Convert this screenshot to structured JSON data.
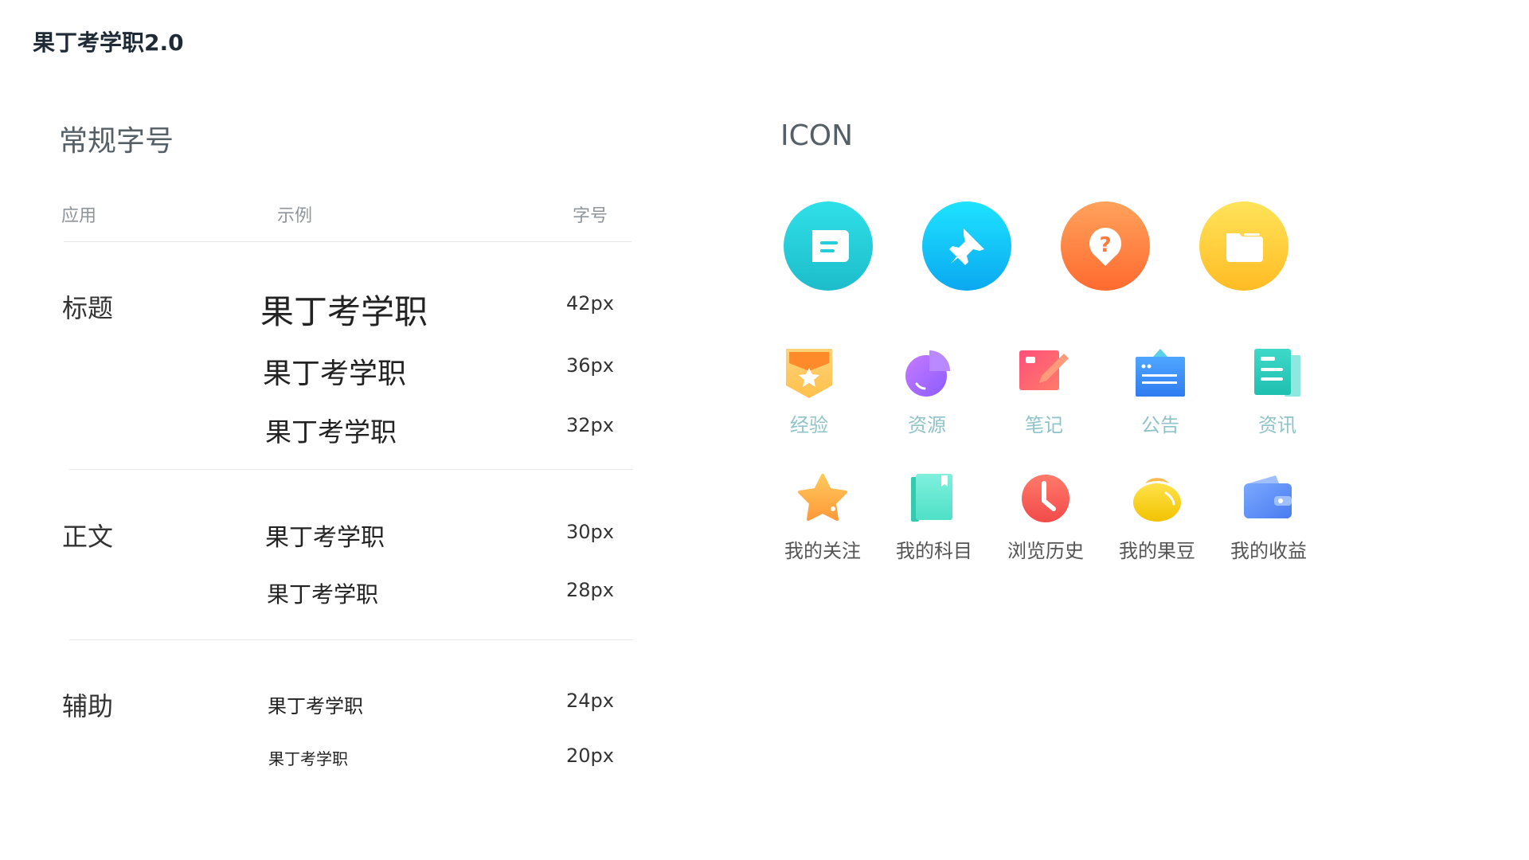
{
  "app": {
    "title": "果丁考学职2.0"
  },
  "typography": {
    "section_title": "常规字号",
    "columns": {
      "usage": "应用",
      "example": "示例",
      "size": "字号"
    },
    "groups": [
      {
        "label": "标题",
        "items": [
          {
            "example": "果丁考学职",
            "size": "42px"
          },
          {
            "example": "果丁考学职",
            "size": "36px"
          },
          {
            "example": "果丁考学职",
            "size": "32px"
          }
        ]
      },
      {
        "label": "正文",
        "items": [
          {
            "example": "果丁考学职",
            "size": "30px"
          },
          {
            "example": "果丁考学职",
            "size": "28px"
          }
        ]
      },
      {
        "label": "辅助",
        "items": [
          {
            "example": "果丁考学职",
            "size": "24px"
          },
          {
            "example": "果丁考学职",
            "size": "20px"
          }
        ]
      }
    ]
  },
  "icons": {
    "section_title": "ICON",
    "large": [
      {
        "name": "message-icon",
        "color_from": "#2fe0e8",
        "color_to": "#1dbccb"
      },
      {
        "name": "pin-icon",
        "color_from": "#1ee3ff",
        "color_to": "#0aa8f0"
      },
      {
        "name": "question-icon",
        "color_from": "#ffa25c",
        "color_to": "#ff6a2f"
      },
      {
        "name": "folder-icon",
        "color_from": "#ffe35a",
        "color_to": "#ffbc24"
      }
    ],
    "row1": [
      {
        "label": "经验",
        "name": "experience-badge-icon"
      },
      {
        "label": "资源",
        "name": "resource-pie-icon"
      },
      {
        "label": "笔记",
        "name": "note-pencil-icon"
      },
      {
        "label": "公告",
        "name": "announcement-icon"
      },
      {
        "label": "资讯",
        "name": "news-document-icon"
      }
    ],
    "row2": [
      {
        "label": "我的关注",
        "name": "star-icon"
      },
      {
        "label": "我的科目",
        "name": "book-icon"
      },
      {
        "label": "浏览历史",
        "name": "clock-icon"
      },
      {
        "label": "我的果豆",
        "name": "bean-icon"
      },
      {
        "label": "我的收益",
        "name": "wallet-icon"
      }
    ]
  }
}
